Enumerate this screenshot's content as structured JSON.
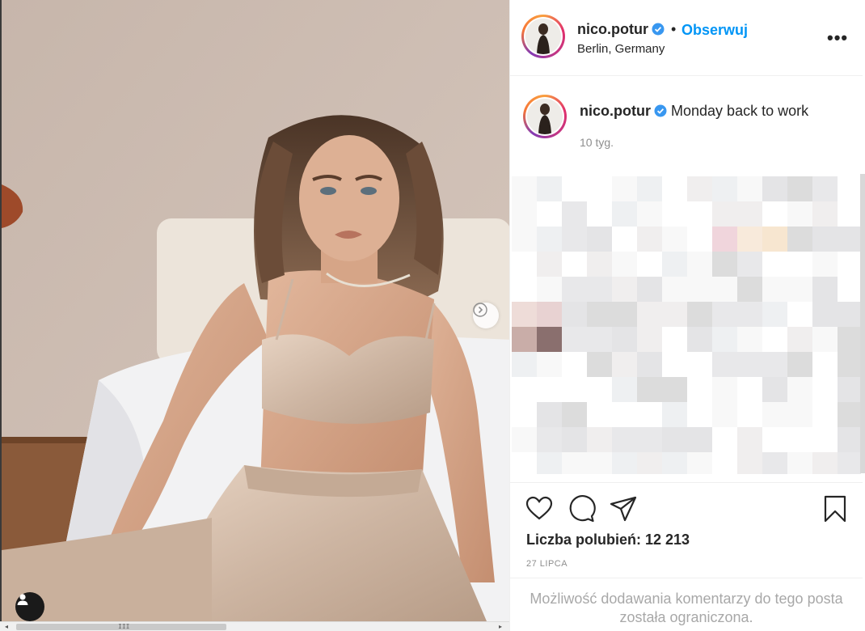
{
  "post": {
    "username": "nico.potur",
    "follow_label": "Obserwuj",
    "separator": "•",
    "location": "Berlin, Germany",
    "more_label": "•••",
    "caption_text": "Monday back to work",
    "time_ago": "10 tyg.",
    "likes_text": "Liczba polubień: 12 213",
    "date": "27 LIPCA",
    "comments_restricted": "Możliwość dodawania komentarzy do tego posta została ograniczona."
  },
  "icons": {
    "verified": "verified-badge-icon",
    "like": "heart-icon",
    "comment": "comment-bubble-icon",
    "share": "paper-plane-icon",
    "save": "bookmark-icon",
    "next": "chevron-right-icon",
    "tags": "user-tag-icon",
    "more": "more-options-icon"
  },
  "colors": {
    "accent": "#0095f6",
    "text": "#262626",
    "muted": "#8e8e8e",
    "border": "#efefef"
  }
}
